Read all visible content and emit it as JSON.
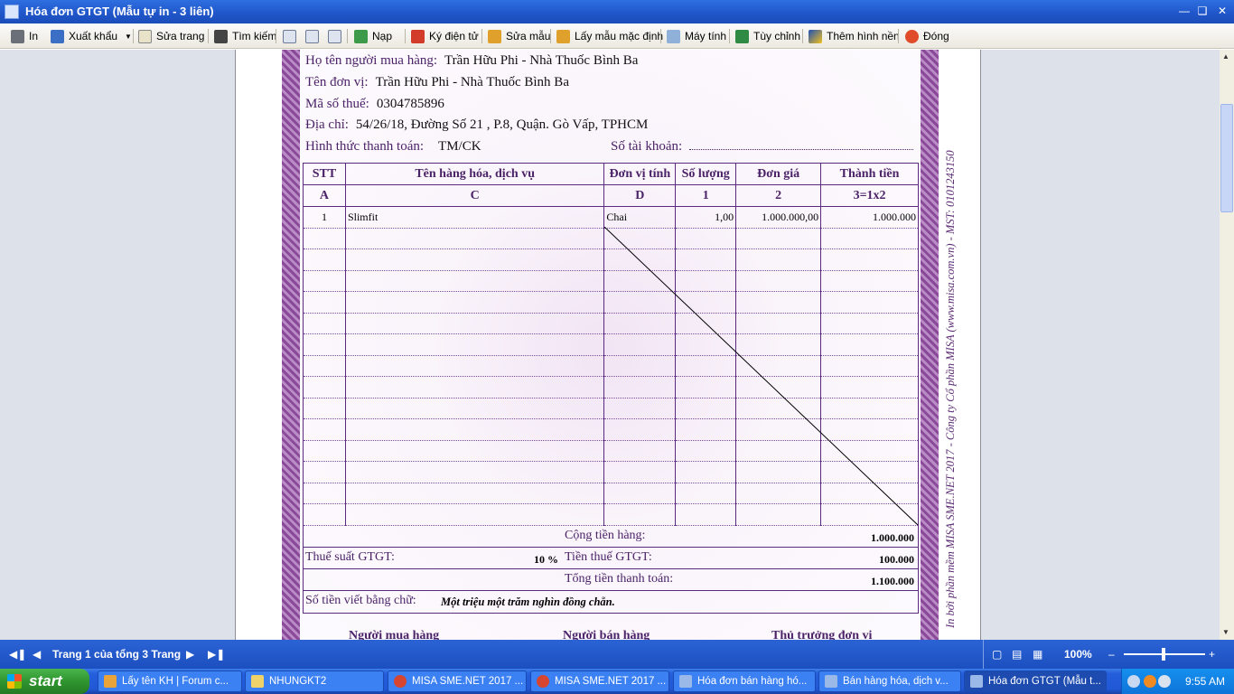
{
  "window": {
    "title": "Hóa đơn GTGT (Mẫu tự in - 3 liên)",
    "minimize_icon": "minimize-icon",
    "restore_icon": "restore-icon",
    "close_icon": "close-icon"
  },
  "toolbar": {
    "print": "In",
    "export": "Xuất khẩu",
    "edit_page": "Sửa trang",
    "search": "Tìm kiếm",
    "load": "Nạp",
    "e_sign": "Ký điện tử",
    "edit_template": "Sửa mẫu",
    "default_template": "Lấy mẫu mặc định",
    "calculator": "Máy tính",
    "customize": "Tùy chỉnh",
    "add_background": "Thêm hình nền",
    "close": "Đóng"
  },
  "invoice": {
    "buyer_label": "Họ tên người mua hàng:",
    "buyer": "Trần Hữu Phi - Nhà Thuốc Bình Ba",
    "company_label": "Tên đơn vị:",
    "company": "Trần Hữu Phi - Nhà Thuốc Bình Ba",
    "tax_label": "Mã số thuế:",
    "tax_code": "0304785896",
    "address_label": "Địa chỉ:",
    "address": "54/26/18, Đường Số 21 , P.8, Quận. Gò Vấp, TPHCM",
    "payment_label": "Hình thức thanh toán:",
    "payment": "TM/CK",
    "account_label": "Số tài khoản:",
    "headers": [
      "STT",
      "Tên hàng hóa, dịch vụ",
      "Đơn vị tính",
      "Số lượng",
      "Đơn giá",
      "Thành tiền"
    ],
    "codes": [
      "A",
      "C",
      "D",
      "1",
      "2",
      "3=1x2"
    ],
    "rows": [
      {
        "stt": "1",
        "name": "Slimfit",
        "unit": "Chai",
        "qty": "1,00",
        "price": "1.000.000,00",
        "amount": "1.000.000"
      }
    ],
    "subtotal_label": "Cộng tiền hàng:",
    "subtotal": "1.000.000",
    "vat_rate_label": "Thuế suất GTGT:",
    "vat_rate": "10 %",
    "vat_label": "Tiền thuế GTGT:",
    "vat": "100.000",
    "total_label": "Tổng tiền thanh toán:",
    "total": "1.100.000",
    "words_label": "Số tiền viết bằng chữ:",
    "words": "Một triệu một trăm nghìn đồng chẵn.",
    "sign_buyer": "Người mua hàng",
    "sign_seller": "Người bán hàng",
    "sign_head": "Thủ trưởng đơn vị",
    "credit": "In bởi phần mềm MISA SME.NET 2017 - Công ty Cổ phần MISA (www.misa.com.vn) - MST: 0101243150"
  },
  "status": {
    "page_info": "Trang 1 của tổng 3 Trang",
    "zoom": "100%"
  },
  "taskbar": {
    "start": "start",
    "tasks": [
      "Lấy tên KH | Forum c...",
      "NHUNGKT2",
      "MISA SME.NET 2017 ...",
      "MISA SME.NET 2017 ...",
      "Hóa đơn bán hàng hó...",
      "Bán hàng hóa, dịch v...",
      "Hóa đơn GTGT (Mẫu t..."
    ],
    "clock": "9:55 AM"
  },
  "colors": {
    "accent": "#4b2268",
    "border": "#5b2a80",
    "xp_blue": "#245edb"
  }
}
